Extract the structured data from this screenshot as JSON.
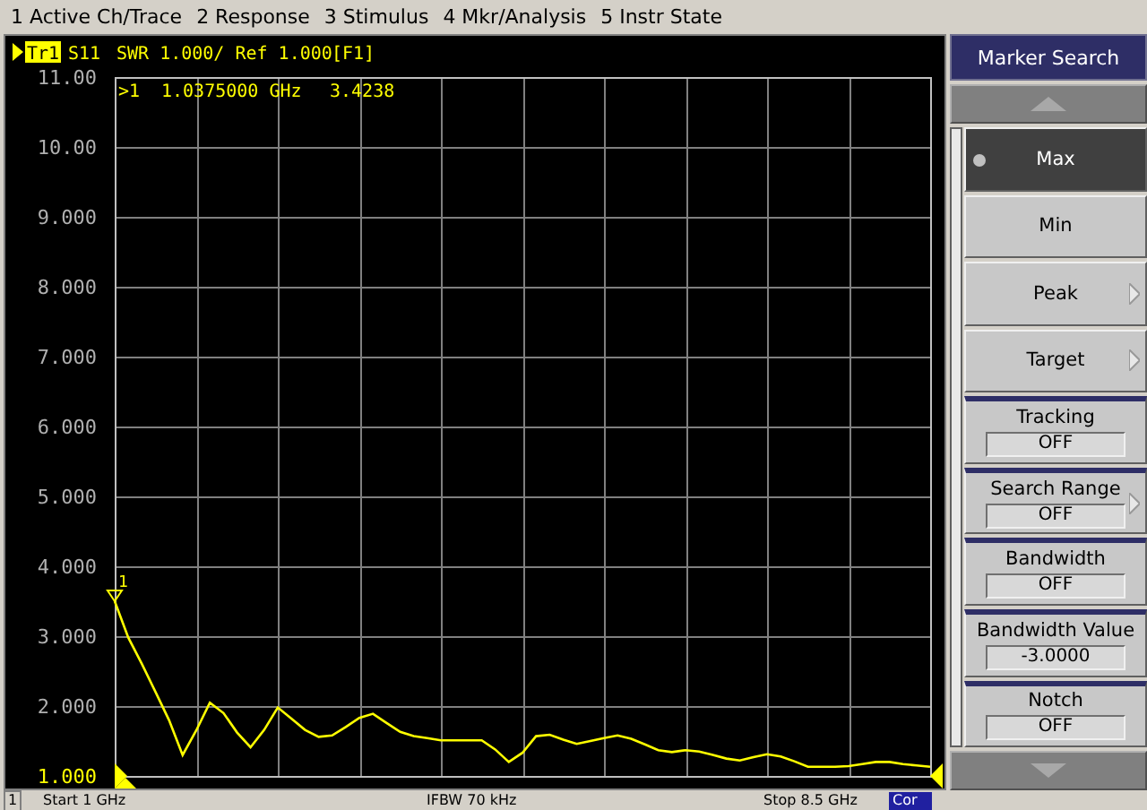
{
  "menu": [
    "1 Active Ch/Trace",
    "2 Response",
    "3 Stimulus",
    "4 Mkr/Analysis",
    "5 Instr State"
  ],
  "trace_header": {
    "trace": "Tr1",
    "format": "SWR 1.000/ Ref 1.000",
    "channel": "[F1]"
  },
  "marker_readout": {
    "label": ">1",
    "frequency": "1.0375000 GHz",
    "value": "3.4238"
  },
  "marker": {
    "label": "1"
  },
  "chart_data": {
    "type": "line",
    "grid": true,
    "ylim": [
      1,
      11
    ],
    "yticks": [
      {
        "value": 1,
        "label": "1.000"
      },
      {
        "value": 2,
        "label": "2.000"
      },
      {
        "value": 3,
        "label": "3.000"
      },
      {
        "value": 4,
        "label": "4.000"
      },
      {
        "value": 5,
        "label": "5.000"
      },
      {
        "value": 6,
        "label": "6.000"
      },
      {
        "value": 7,
        "label": "7.000"
      },
      {
        "value": 8,
        "label": "8.000"
      },
      {
        "value": 9,
        "label": "9.000"
      },
      {
        "value": 10,
        "label": "10.00"
      },
      {
        "value": 11,
        "label": "11.00"
      }
    ],
    "categories": [
      null,
      null,
      null,
      null,
      null,
      null,
      null,
      null,
      null,
      null,
      null,
      null,
      null,
      null,
      null,
      null,
      null,
      null,
      null,
      null,
      null,
      null,
      null,
      null,
      null,
      null,
      null,
      null,
      null,
      null,
      null,
      null,
      null,
      null,
      null,
      null,
      null,
      null,
      null,
      null,
      null,
      null,
      null,
      null,
      null,
      null,
      null,
      null,
      null,
      null,
      null,
      null,
      null,
      null,
      null,
      null,
      null,
      null,
      null,
      null,
      null
    ],
    "series": [
      {
        "name": "S11",
        "color": "#ffff00",
        "values": [
          3.5,
          2.98,
          2.6,
          2.2,
          1.8,
          1.3,
          1.65,
          2.05,
          1.9,
          1.62,
          1.41,
          1.66,
          1.98,
          1.82,
          1.66,
          1.56,
          1.58,
          1.7,
          1.83,
          1.89,
          1.76,
          1.63,
          1.57,
          1.54,
          1.51,
          1.51,
          1.51,
          1.51,
          1.38,
          1.2,
          1.33,
          1.57,
          1.59,
          1.52,
          1.46,
          1.5,
          1.54,
          1.58,
          1.53,
          1.45,
          1.37,
          1.34,
          1.37,
          1.35,
          1.3,
          1.25,
          1.22,
          1.27,
          1.31,
          1.28,
          1.21,
          1.13,
          1.13,
          1.13,
          1.14,
          1.17,
          1.2,
          1.2,
          1.17,
          1.15,
          1.13
        ]
      }
    ]
  },
  "softkey_panel": {
    "title": "Marker Search",
    "items": [
      {
        "kind": "button",
        "label": "Max",
        "selected": true
      },
      {
        "kind": "button",
        "label": "Min",
        "selected": false
      },
      {
        "kind": "submenu",
        "label": "Peak",
        "selected": false
      },
      {
        "kind": "submenu",
        "label": "Target",
        "selected": false
      },
      {
        "kind": "value",
        "label": "Tracking",
        "value": "OFF",
        "selected": false
      },
      {
        "kind": "value_submenu",
        "label": "Search Range",
        "value": "OFF",
        "selected": false
      },
      {
        "kind": "value",
        "label": "Bandwidth",
        "value": "OFF",
        "selected": false
      },
      {
        "kind": "value",
        "label": "Bandwidth Value",
        "value": "-3.0000",
        "selected": false
      },
      {
        "kind": "value",
        "label": "Notch",
        "value": "OFF",
        "selected": false
      }
    ]
  },
  "status_bar": {
    "channel": "1",
    "start": "Start 1 GHz",
    "ifbw": "IFBW 70 kHz",
    "stop": "Stop 8.5 GHz",
    "correction": "Cor"
  }
}
